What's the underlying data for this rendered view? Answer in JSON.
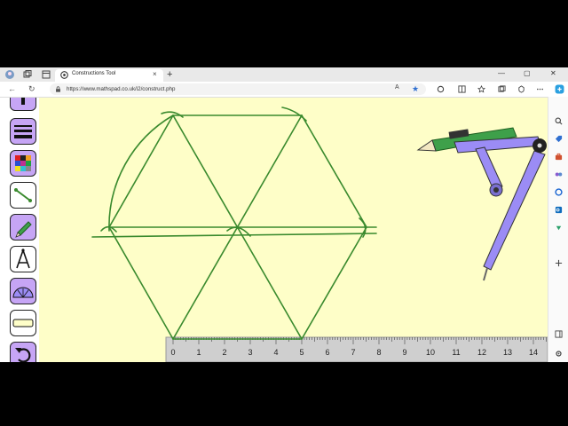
{
  "browser": {
    "tab_title": "Constructions Tool",
    "tab_close": "×",
    "new_tab": "+",
    "url": "https://www.mathspad.co.uk/i2/construct.php",
    "win_min": "—",
    "win_max": "▢",
    "win_close": "✕",
    "back": "←",
    "refresh": "↻",
    "reader": "A",
    "favorite": "★"
  },
  "toolbar": {
    "tools": [
      "partial-tool",
      "line-thickness",
      "colour-palette",
      "line-segment",
      "pencil",
      "compass",
      "protractor",
      "ruler",
      "undo"
    ]
  },
  "ruler": {
    "labels": [
      "0",
      "1",
      "2",
      "3",
      "4",
      "5",
      "6",
      "7",
      "8",
      "9",
      "10",
      "11",
      "12",
      "13",
      "14"
    ]
  },
  "colors": {
    "page_background": "#fefec8",
    "construction_green": "#3a8a2e",
    "tool_purple": "#c6a5f5",
    "compass_purple": "#9b8cf5",
    "ruler_grey": "#cfcfcf"
  }
}
